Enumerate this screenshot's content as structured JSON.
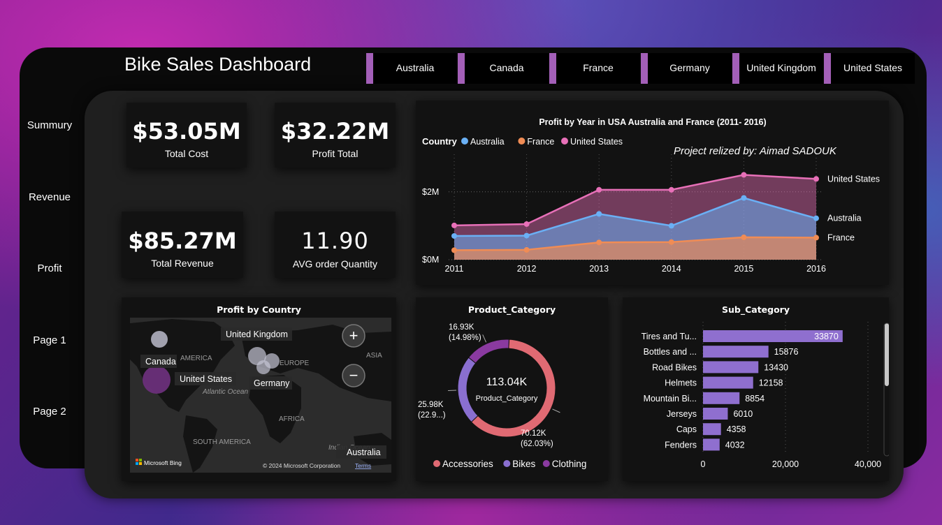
{
  "header": {
    "title": "Bike Sales Dashboard",
    "slicers": [
      "Australia",
      "Canada",
      "France",
      "Germany",
      "United Kingdom",
      "United States"
    ]
  },
  "nav": [
    "Summury",
    "Revenue",
    "Profit",
    "Page 1",
    "Page 2"
  ],
  "kpis": {
    "total_cost": {
      "value": "$53.05M",
      "label": "Total Cost"
    },
    "profit_total": {
      "value": "$32.22M",
      "label": "Profit Total"
    },
    "total_revenue": {
      "value": "$85.27M",
      "label": "Total Revenue"
    },
    "avg_order_qty": {
      "value": "11.90",
      "label": "AVG order Quantity"
    }
  },
  "line_chart_header": {
    "title": "Profit by Year in USA Australia and France (2011- 2016)",
    "legend_title": "Country",
    "credit": "Project relized by: Aimad SADOUK"
  },
  "map": {
    "title": "Profit by Country",
    "labels": [
      "United Kingdom",
      "Canada",
      "United States",
      "Germany",
      "Australia"
    ],
    "base_labels": [
      "AMERICA",
      "EUROPE",
      "ASIA",
      "Atlantic Ocean",
      "AFRICA",
      "SOUTH AMERICA",
      "Indian Ocean"
    ],
    "zoom_in": "+",
    "zoom_out": "−",
    "logo_text": "Microsoft Bing",
    "copyright": "© 2024 Microsoft Corporation",
    "terms": "Terms"
  },
  "donut_header": {
    "title": "Product_Category",
    "center_value": "113.04K",
    "center_label": "Product_Category"
  },
  "bar_header": {
    "title": "Sub_Category"
  },
  "colors": {
    "australia": "#6ab0f5",
    "france": "#f08c55",
    "us": "#e870b8",
    "accessories": "#e06a73",
    "bikes": "#8a6fd0",
    "clothing": "#8a3aa0",
    "bar": "#8f6fcf"
  },
  "chart_data": [
    {
      "type": "line",
      "title": "Profit by Year in USA Australia and France (2011- 2016)",
      "x": [
        2011,
        2012,
        2013,
        2014,
        2015,
        2016
      ],
      "ylim": [
        0,
        2900000
      ],
      "yticks": [
        "$0M",
        "$2M"
      ],
      "series": [
        {
          "name": "Australia",
          "values": [
            700000,
            710000,
            1350000,
            1000000,
            1820000,
            1220000
          ],
          "end_label": "Australia"
        },
        {
          "name": "France",
          "values": [
            280000,
            290000,
            510000,
            520000,
            660000,
            650000
          ],
          "end_label": "France"
        },
        {
          "name": "United States",
          "values": [
            1010000,
            1050000,
            2060000,
            2060000,
            2500000,
            2380000
          ],
          "end_label": "United States"
        }
      ]
    },
    {
      "type": "pie",
      "title": "Product_Category",
      "categories": [
        "Accessories",
        "Bikes",
        "Clothing"
      ],
      "values": [
        70.12,
        25.98,
        16.93
      ],
      "labels": [
        "70.12K\n(62.03%)",
        "25.98K\n(22.9...)",
        "16.93K\n(14.98%)"
      ]
    },
    {
      "type": "bar",
      "title": "Sub_Category",
      "categories": [
        "Tires and Tu...",
        "Bottles and ...",
        "Road Bikes",
        "Helmets",
        "Mountain Bi...",
        "Jerseys",
        "Caps",
        "Fenders"
      ],
      "values": [
        33870,
        15876,
        13430,
        12158,
        8854,
        6010,
        4358,
        4032
      ],
      "xticks": [
        "0",
        "20,000",
        "40,000"
      ],
      "xlim": [
        0,
        40000
      ]
    }
  ]
}
